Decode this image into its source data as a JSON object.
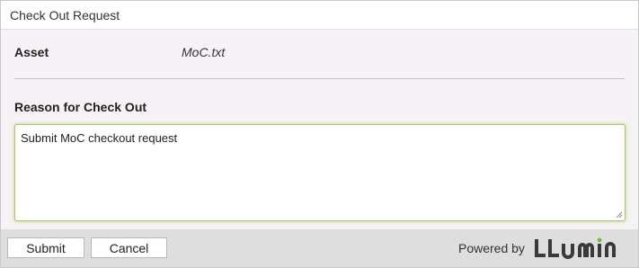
{
  "dialog": {
    "title": "Check Out Request"
  },
  "form": {
    "asset_label": "Asset",
    "asset_value": "MoC.txt",
    "reason_label": "Reason for Check Out",
    "reason_value": "Submit MoC checkout request"
  },
  "footer": {
    "submit_label": "Submit",
    "cancel_label": "Cancel",
    "powered_by_label": "Powered by",
    "logo_text": "LLUMIN",
    "logo_icon": "llumin-logo",
    "logo_color": "#3a3a3a",
    "logo_accent": "#7ab648"
  }
}
